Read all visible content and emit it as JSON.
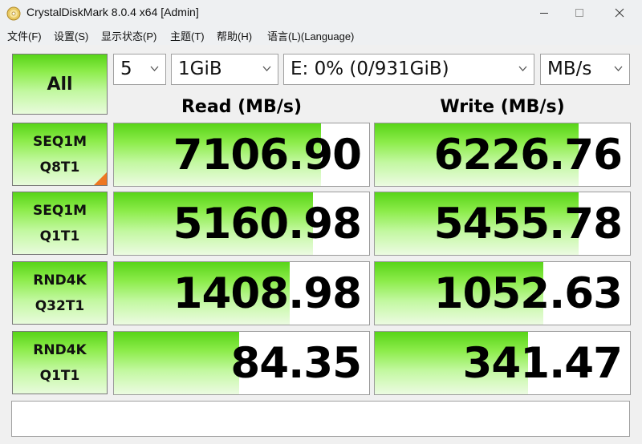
{
  "window": {
    "title": "CrystalDiskMark 8.0.4 x64 [Admin]"
  },
  "menu": [
    {
      "label": "文件(F)"
    },
    {
      "label": "设置(S)"
    },
    {
      "label": "显示状态(P)"
    },
    {
      "label": "主题(T)"
    },
    {
      "label": "帮助(H)"
    },
    {
      "label": "语言(L)(Language)"
    }
  ],
  "controls": {
    "all_label": "All",
    "count": "5",
    "size": "1GiB",
    "drive": "E: 0% (0/931GiB)",
    "unit": "MB/s"
  },
  "headers": {
    "read": "Read (MB/s)",
    "write": "Write (MB/s)"
  },
  "tests": [
    {
      "line1": "SEQ1M",
      "line2": "Q8T1",
      "read": "7106.90",
      "write": "6226.76",
      "read_fill": 0.81,
      "write_fill": 0.8,
      "marked": true
    },
    {
      "line1": "SEQ1M",
      "line2": "Q1T1",
      "read": "5160.98",
      "write": "5455.78",
      "read_fill": 0.78,
      "write_fill": 0.8,
      "marked": false
    },
    {
      "line1": "RND4K",
      "line2": "Q32T1",
      "read": "1408.98",
      "write": "1052.63",
      "read_fill": 0.69,
      "write_fill": 0.66,
      "marked": false
    },
    {
      "line1": "RND4K",
      "line2": "Q1T1",
      "read": "84.35",
      "write": "341.47",
      "read_fill": 0.49,
      "write_fill": 0.6,
      "marked": false
    }
  ],
  "status": "",
  "colors": {
    "accent_green": "#58d418",
    "marker_orange": "#ee7722"
  },
  "icons": {
    "app": "crystaldiskmark-disc-icon",
    "minimize": "minimize-icon",
    "maximize": "maximize-icon",
    "close": "close-icon",
    "dropdown": "chevron-down-icon"
  }
}
